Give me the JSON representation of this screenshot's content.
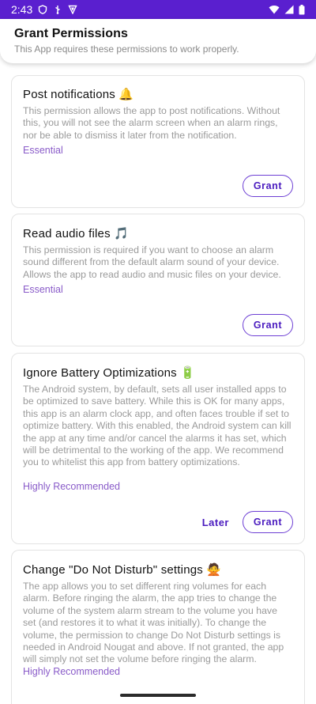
{
  "status_bar": {
    "time": "2:43",
    "left_icons": [
      "shield-icon",
      "usb-icon",
      "vpn-shield-icon"
    ],
    "right_icons": [
      "wifi-icon",
      "signal-icon",
      "battery-icon"
    ]
  },
  "header": {
    "title": "Grant Permissions",
    "subtitle": "This App requires these permissions to work properly."
  },
  "permissions": [
    {
      "title": "Post notifications 🔔",
      "description": "This permission allows the app to post notifications. Without this, you will not see the alarm screen when an alarm rings, nor be able to dismiss it later from the notification.",
      "tag": "Essential",
      "grant_label": "Grant"
    },
    {
      "title": "Read audio files 🎵",
      "description": "This permission is required if you want to choose an alarm sound different from the default alarm sound of your device. Allows the app to read audio and music files on your device.",
      "tag": "Essential",
      "grant_label": "Grant"
    },
    {
      "title": "Ignore Battery Optimizations 🔋",
      "description": "The Android system, by default, sets all user installed apps to be optimized to save battery. While this is OK for many apps, this app is an alarm clock app, and often faces trouble if set to optimize battery. With this enabled, the Android system can kill the app at any time and/or cancel the alarms it has set, which will be detrimental to the working of the app. We recommend you to whitelist this app from battery optimizations.",
      "tag": "Highly Recommended",
      "later_label": "Later",
      "grant_label": "Grant"
    },
    {
      "title": "Change \"Do Not Disturb\" settings 🙅",
      "description": "The app allows you to set different ring volumes for each alarm. Before ringing the alarm, the app tries to change the volume of the system alarm stream to the volume you have set (and restores it to what it was initially). To change the volume, the permission to change Do Not Disturb settings is needed in Android Nougat and above. If not granted, the app will simply not set the volume before ringing the alarm.",
      "tag": "Highly Recommended"
    }
  ],
  "colors": {
    "status_bar": "#5a1fcf",
    "accent": "#4a1bbf",
    "tag": "#8a5cc9"
  }
}
